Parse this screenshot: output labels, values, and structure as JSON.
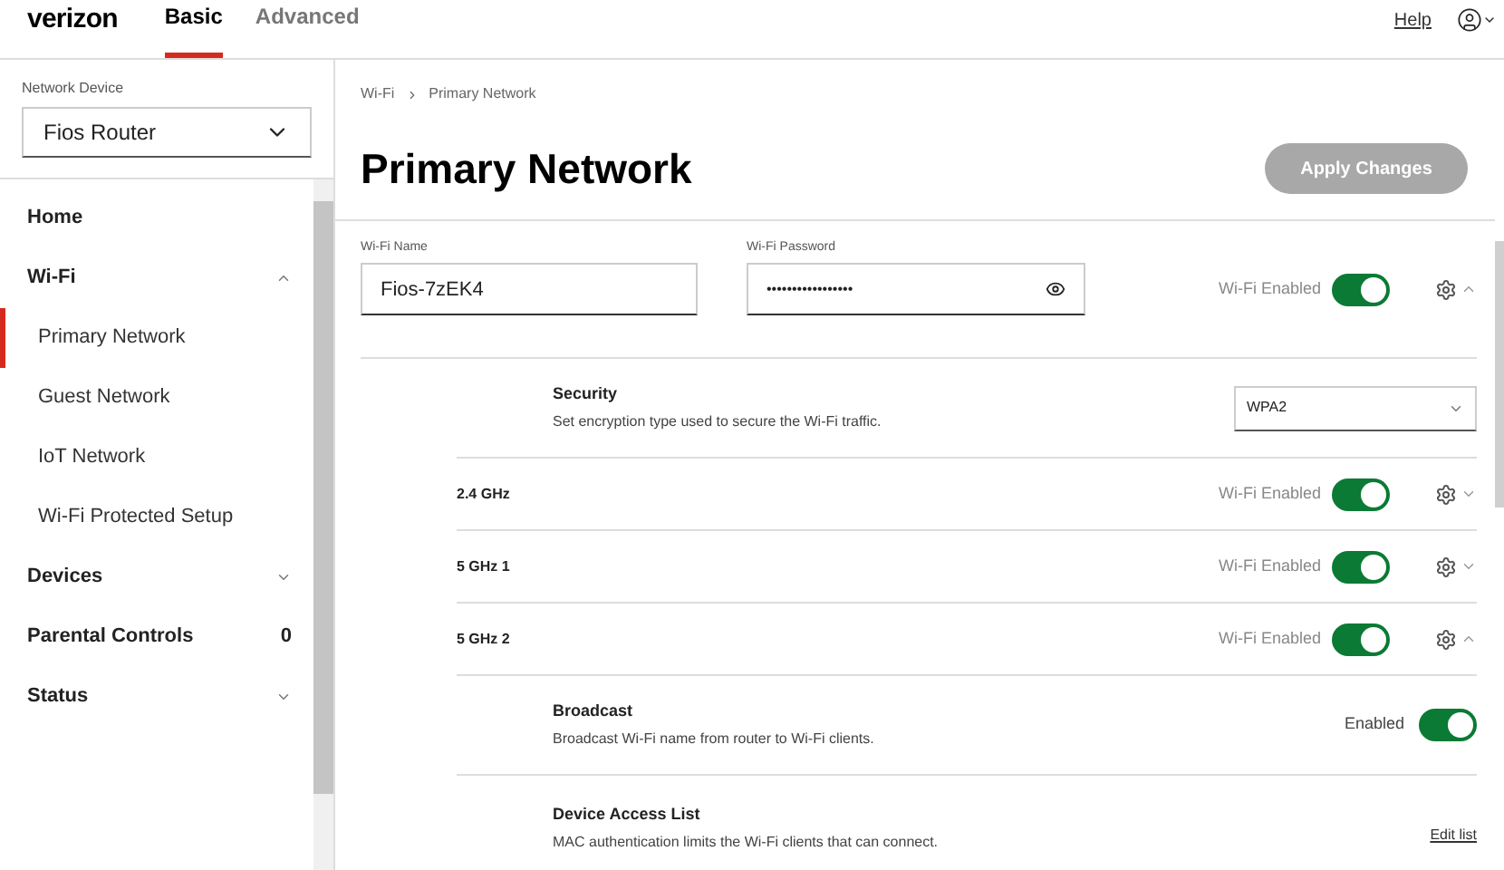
{
  "header": {
    "logo": "verizon",
    "tabs": [
      {
        "label": "Basic",
        "selected": true
      },
      {
        "label": "Advanced",
        "selected": false
      }
    ],
    "help": "Help"
  },
  "sidebar": {
    "device_label": "Network Device",
    "device_value": "Fios Router",
    "items": [
      {
        "label": "Home",
        "selected": false
      },
      {
        "label": "Wi-Fi",
        "selected": false,
        "expanded": true,
        "children": [
          {
            "label": "Primary Network",
            "selected": true
          },
          {
            "label": "Guest Network",
            "selected": false
          },
          {
            "label": "IoT Network",
            "selected": false
          },
          {
            "label": "Wi-Fi Protected Setup",
            "selected": false
          }
        ]
      },
      {
        "label": "Devices",
        "selected": false,
        "expanded": false
      },
      {
        "label": "Parental Controls",
        "selected": false,
        "badge": "0"
      },
      {
        "label": "Status",
        "selected": false,
        "expanded": false
      }
    ]
  },
  "main": {
    "breadcrumb": [
      "Wi-Fi",
      "Primary Network"
    ],
    "title": "Primary Network",
    "apply_button": {
      "label": "Apply Changes",
      "disabled": true
    },
    "network": {
      "name_label": "Wi-Fi Name",
      "name_value": "Fios-7zEK4",
      "password_label": "Wi-Fi Password",
      "password_value": "•••••••••••••••••",
      "toggle_label": "Wi-Fi Enabled",
      "enabled": true,
      "expanded": true
    },
    "security": {
      "title": "Security",
      "description": "Set encryption type used to secure the Wi-Fi traffic.",
      "value": "WPA2"
    },
    "bands": [
      {
        "label": "2.4 GHz",
        "toggle_label": "Wi-Fi Enabled",
        "enabled": true,
        "expanded": false
      },
      {
        "label": "5 GHz 1",
        "toggle_label": "Wi-Fi Enabled",
        "enabled": true,
        "expanded": false
      },
      {
        "label": "5 GHz 2",
        "toggle_label": "Wi-Fi Enabled",
        "enabled": true,
        "expanded": true
      }
    ],
    "broadcast": {
      "title": "Broadcast",
      "description": "Broadcast Wi-Fi name from router to Wi-Fi clients.",
      "toggle_label": "Enabled",
      "enabled": true
    },
    "access_list": {
      "title": "Device Access List",
      "description": "MAC authentication limits the Wi-Fi clients that can connect.",
      "link": "Edit list"
    }
  }
}
